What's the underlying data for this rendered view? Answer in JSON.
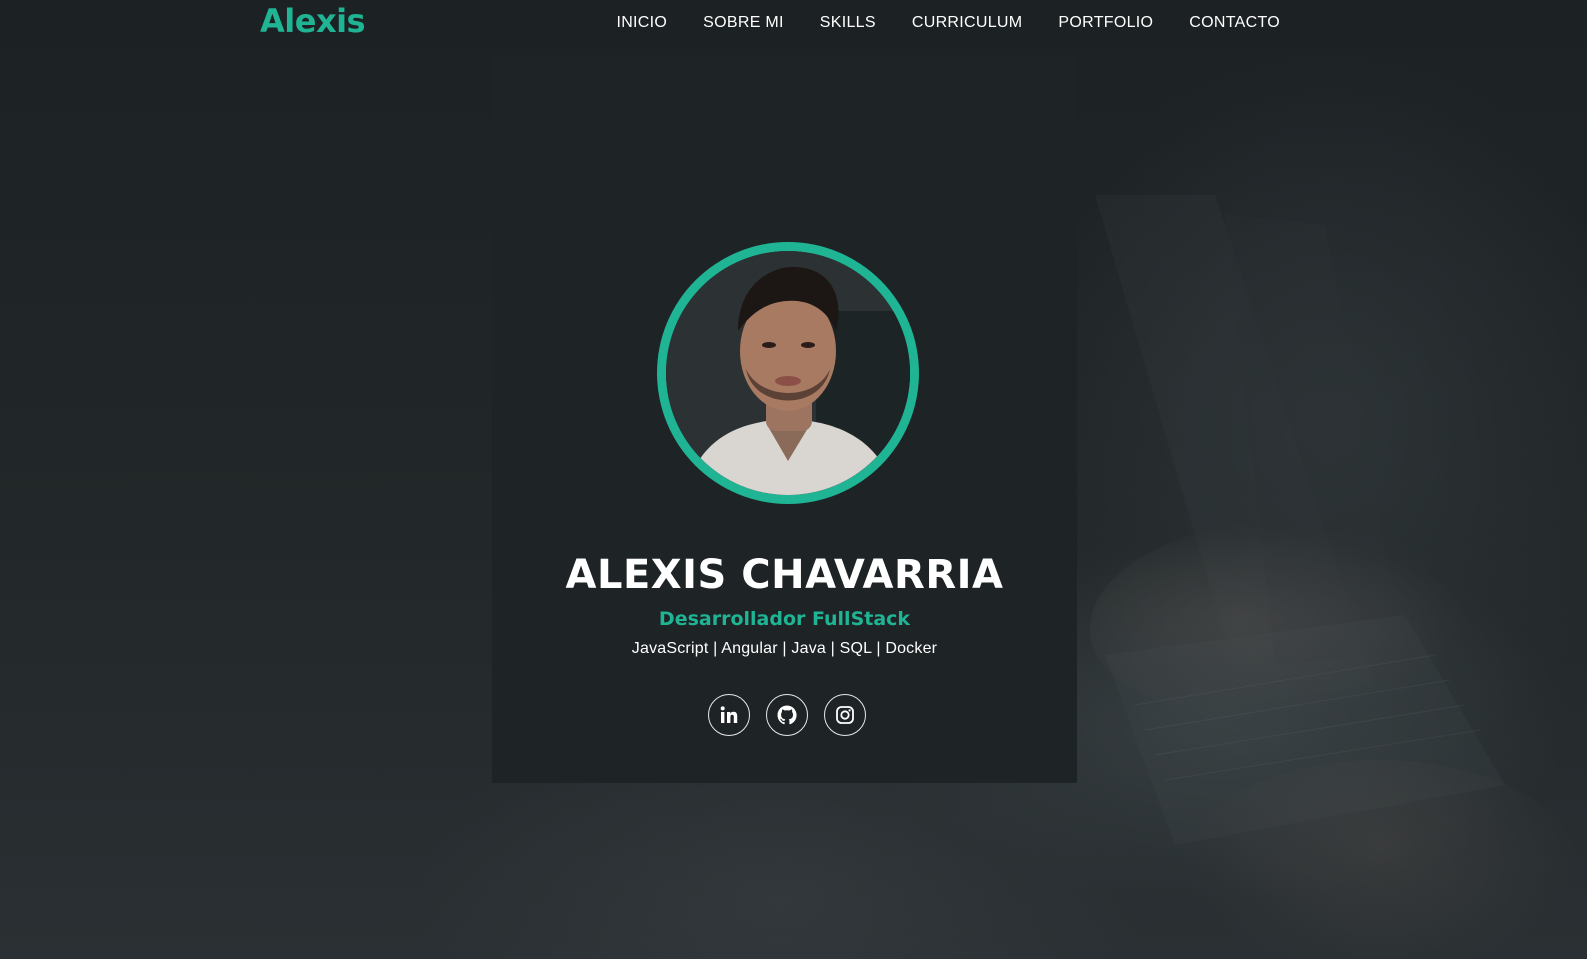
{
  "brand": {
    "logo_text": "Alexis",
    "accent_color": "#1fb493"
  },
  "nav": {
    "items": [
      {
        "label": "INICIO"
      },
      {
        "label": "SOBRE MI"
      },
      {
        "label": "SKILLS"
      },
      {
        "label": "CURRICULUM"
      },
      {
        "label": "PORTFOLIO"
      },
      {
        "label": "CONTACTO"
      }
    ]
  },
  "hero": {
    "name": "ALEXIS CHAVARRIA",
    "role": "Desarrollador FullStack",
    "stack": "JavaScript | Angular | Java | SQL | Docker",
    "avatar_icon": "profile-photo",
    "socials": [
      {
        "icon": "linkedin-icon"
      },
      {
        "icon": "github-icon"
      },
      {
        "icon": "instagram-icon"
      }
    ]
  },
  "colors": {
    "background": "#1e2326",
    "text": "#ffffff"
  }
}
